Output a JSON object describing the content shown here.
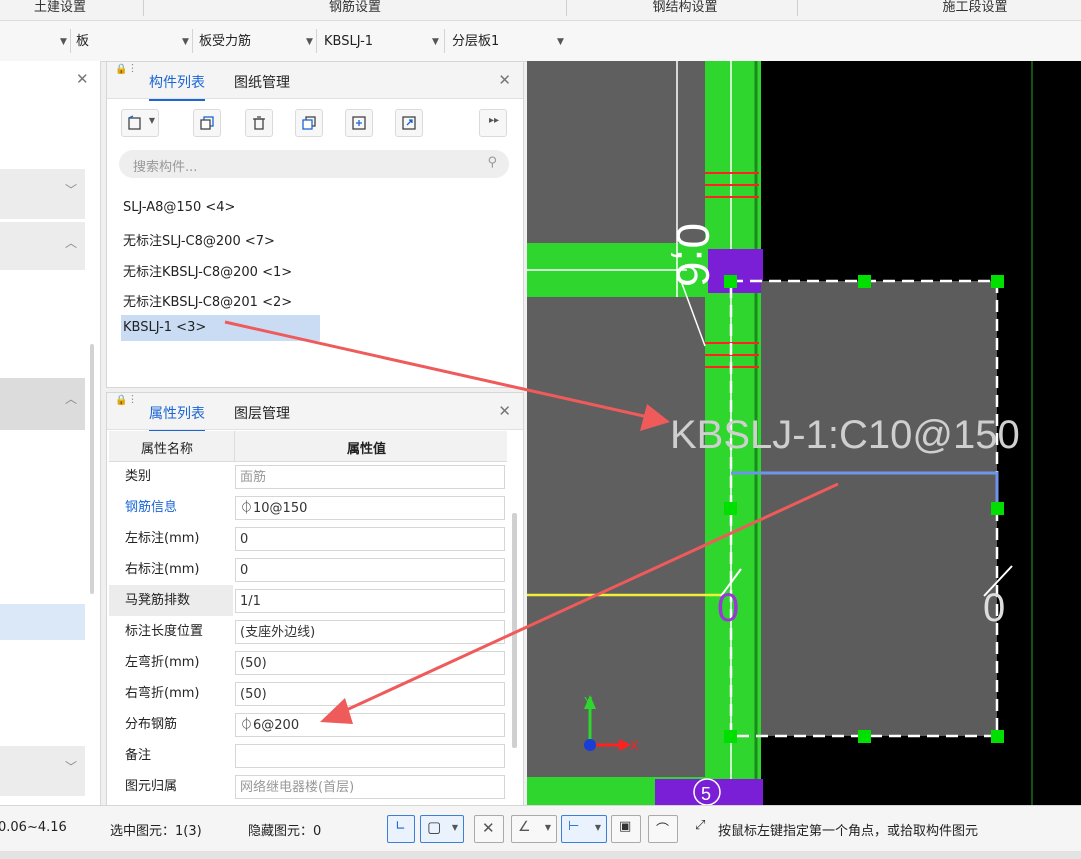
{
  "ribbon": {
    "tabs": [
      "土建设置",
      "钢筋设置",
      "钢结构设置",
      "施工段设置"
    ]
  },
  "toolbar": {
    "selectors": [
      "板",
      "板受力筋",
      "KBSLJ-1",
      "分层板1"
    ]
  },
  "component_panel": {
    "tabs": [
      "构件列表",
      "图纸管理"
    ],
    "search_placeholder": "搜索构件...",
    "items": [
      "SLJ-A8@150 <4>",
      "无标注SLJ-C8@200 <7>",
      "无标注KBSLJ-C8@200 <1>",
      "无标注KBSLJ-C8@201 <2>",
      "KBSLJ-1 <3>"
    ],
    "selected_item": "KBSLJ-1 <3>"
  },
  "property_panel": {
    "tabs": [
      "属性列表",
      "图层管理"
    ],
    "header": {
      "name": "属性名称",
      "value": "属性值"
    },
    "rows": [
      {
        "name": "类别",
        "value": "面筋"
      },
      {
        "name": "钢筋信息",
        "value": "⏀10@150"
      },
      {
        "name": "左标注(mm)",
        "value": "0"
      },
      {
        "name": "右标注(mm)",
        "value": "0"
      },
      {
        "name": "马凳筋排数",
        "value": "1/1"
      },
      {
        "name": "标注长度位置",
        "value": "(支座外边线)"
      },
      {
        "name": "左弯折(mm)",
        "value": "(50)"
      },
      {
        "name": "右弯折(mm)",
        "value": "(50)"
      },
      {
        "name": "分布钢筋",
        "value": "⏀6@200"
      },
      {
        "name": "备注",
        "value": ""
      },
      {
        "name": "图元归属",
        "value": "网络继电器楼(首层)"
      }
    ]
  },
  "canvas": {
    "rebar_label": "KBSLJ-1:C10@150",
    "dim_label_top": "0;6",
    "dim_label_mid_left": "0",
    "dim_label_mid_right": "0",
    "circle_label": "5",
    "axis_x": "X",
    "axis_y": "Y"
  },
  "status": {
    "elevation": "0.06~4.16",
    "selected": "选中图元：1(3)",
    "hidden": "隐藏图元：0",
    "hint": "按鼠标左键指定第一个角点，或拾取构件图元"
  },
  "colors": {
    "accent": "#1a66d6",
    "annotation_arrow": "#ef5a5a",
    "slab_green": "#2ed62e",
    "slab_gray": "#5f5f5f",
    "purple_mark": "#7a1fd6"
  }
}
